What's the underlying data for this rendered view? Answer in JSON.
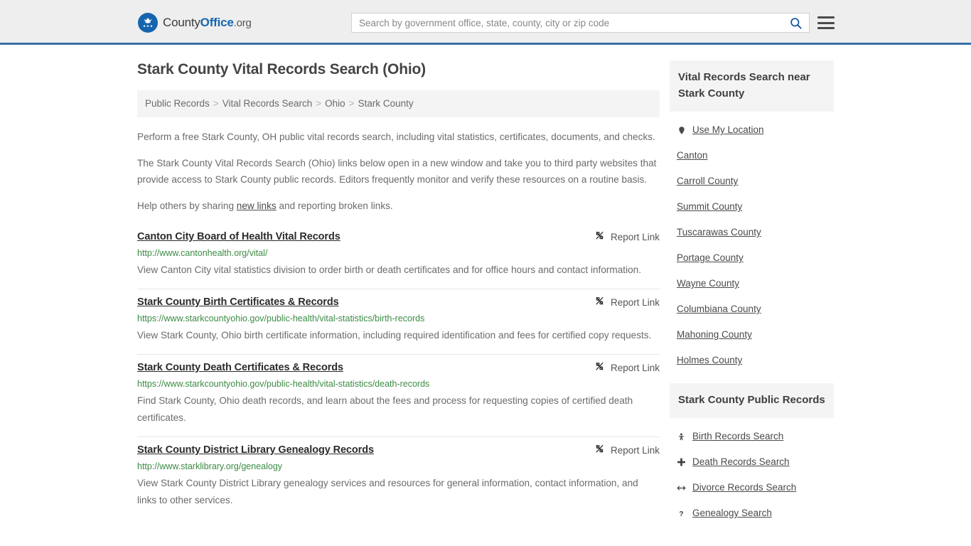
{
  "site": {
    "brand_plain_1": "County",
    "brand_bold": "Office",
    "brand_org": ".org",
    "logo_icon": "eagle-stars-logo-icon"
  },
  "search": {
    "placeholder": "Search by government office, state, county, city or zip code",
    "value": "",
    "search_icon": "search-icon",
    "menu_icon": "hamburger-menu-icon"
  },
  "page": {
    "title": "Stark County Vital Records Search (Ohio)"
  },
  "breadcrumb": {
    "separator": ">",
    "items": [
      {
        "label": "Public Records"
      },
      {
        "label": "Vital Records Search"
      },
      {
        "label": "Ohio"
      },
      {
        "label": "Stark County"
      }
    ]
  },
  "intro": {
    "p1": "Perform a free Stark County, OH public vital records search, including vital statistics, certificates, documents, and checks.",
    "p2": "The Stark County Vital Records Search (Ohio) links below open in a new window and take you to third party websites that provide access to Stark County public records. Editors frequently monitor and verify these resources on a routine basis.",
    "p3_before": "Help others by sharing ",
    "p3_link": "new links",
    "p3_after": " and reporting broken links."
  },
  "report_link_label": "Report Link",
  "report_link_icon": "broken-link-icon",
  "results": [
    {
      "title": "Canton City Board of Health Vital Records",
      "url": "http://www.cantonhealth.org/vital/",
      "description": "View Canton City vital statistics division to order birth or death certificates and for office hours and contact information.",
      "report_label": "Report Link"
    },
    {
      "title": "Stark County Birth Certificates & Records",
      "url": "https://www.starkcountyohio.gov/public-health/vital-statistics/birth-records",
      "description": "View Stark County, Ohio birth certificate information, including required identification and fees for certified copy requests.",
      "report_label": "Report Link"
    },
    {
      "title": "Stark County Death Certificates & Records",
      "url": "https://www.starkcountyohio.gov/public-health/vital-statistics/death-records",
      "description": "Find Stark County, Ohio death records, and learn about the fees and process for requesting copies of certified death certificates.",
      "report_label": "Report Link"
    },
    {
      "title": "Stark County District Library Genealogy Records",
      "url": "http://www.starklibrary.org/genealogy",
      "description": "View Stark County District Library genealogy services and resources for general information, contact information, and links to other services.",
      "report_label": "Report Link"
    }
  ],
  "sidebar": {
    "nearby": {
      "heading": "Vital Records Search near Stark County",
      "items": [
        {
          "label": "Use My Location",
          "icon": "map-pin-icon"
        },
        {
          "label": "Canton",
          "icon": ""
        },
        {
          "label": "Carroll County",
          "icon": ""
        },
        {
          "label": "Summit County",
          "icon": ""
        },
        {
          "label": "Tuscarawas County",
          "icon": ""
        },
        {
          "label": "Portage County",
          "icon": ""
        },
        {
          "label": "Wayne County",
          "icon": ""
        },
        {
          "label": "Columbiana County",
          "icon": ""
        },
        {
          "label": "Mahoning County",
          "icon": ""
        },
        {
          "label": "Holmes County",
          "icon": ""
        }
      ]
    },
    "public_records": {
      "heading": "Stark County Public Records",
      "items": [
        {
          "label": "Birth Records Search",
          "icon": "baby-icon"
        },
        {
          "label": "Death Records Search",
          "icon": "cross-icon"
        },
        {
          "label": "Divorce Records Search",
          "icon": "left-right-arrow-icon"
        },
        {
          "label": "Genealogy Search",
          "icon": "question-mark-icon"
        }
      ]
    }
  },
  "colors": {
    "brand_blue": "#1565ae",
    "header_bg": "#eeeeee",
    "header_border": "#3a6ea5",
    "url_green": "#3d8b45",
    "panel_gray": "#f4f4f4"
  }
}
